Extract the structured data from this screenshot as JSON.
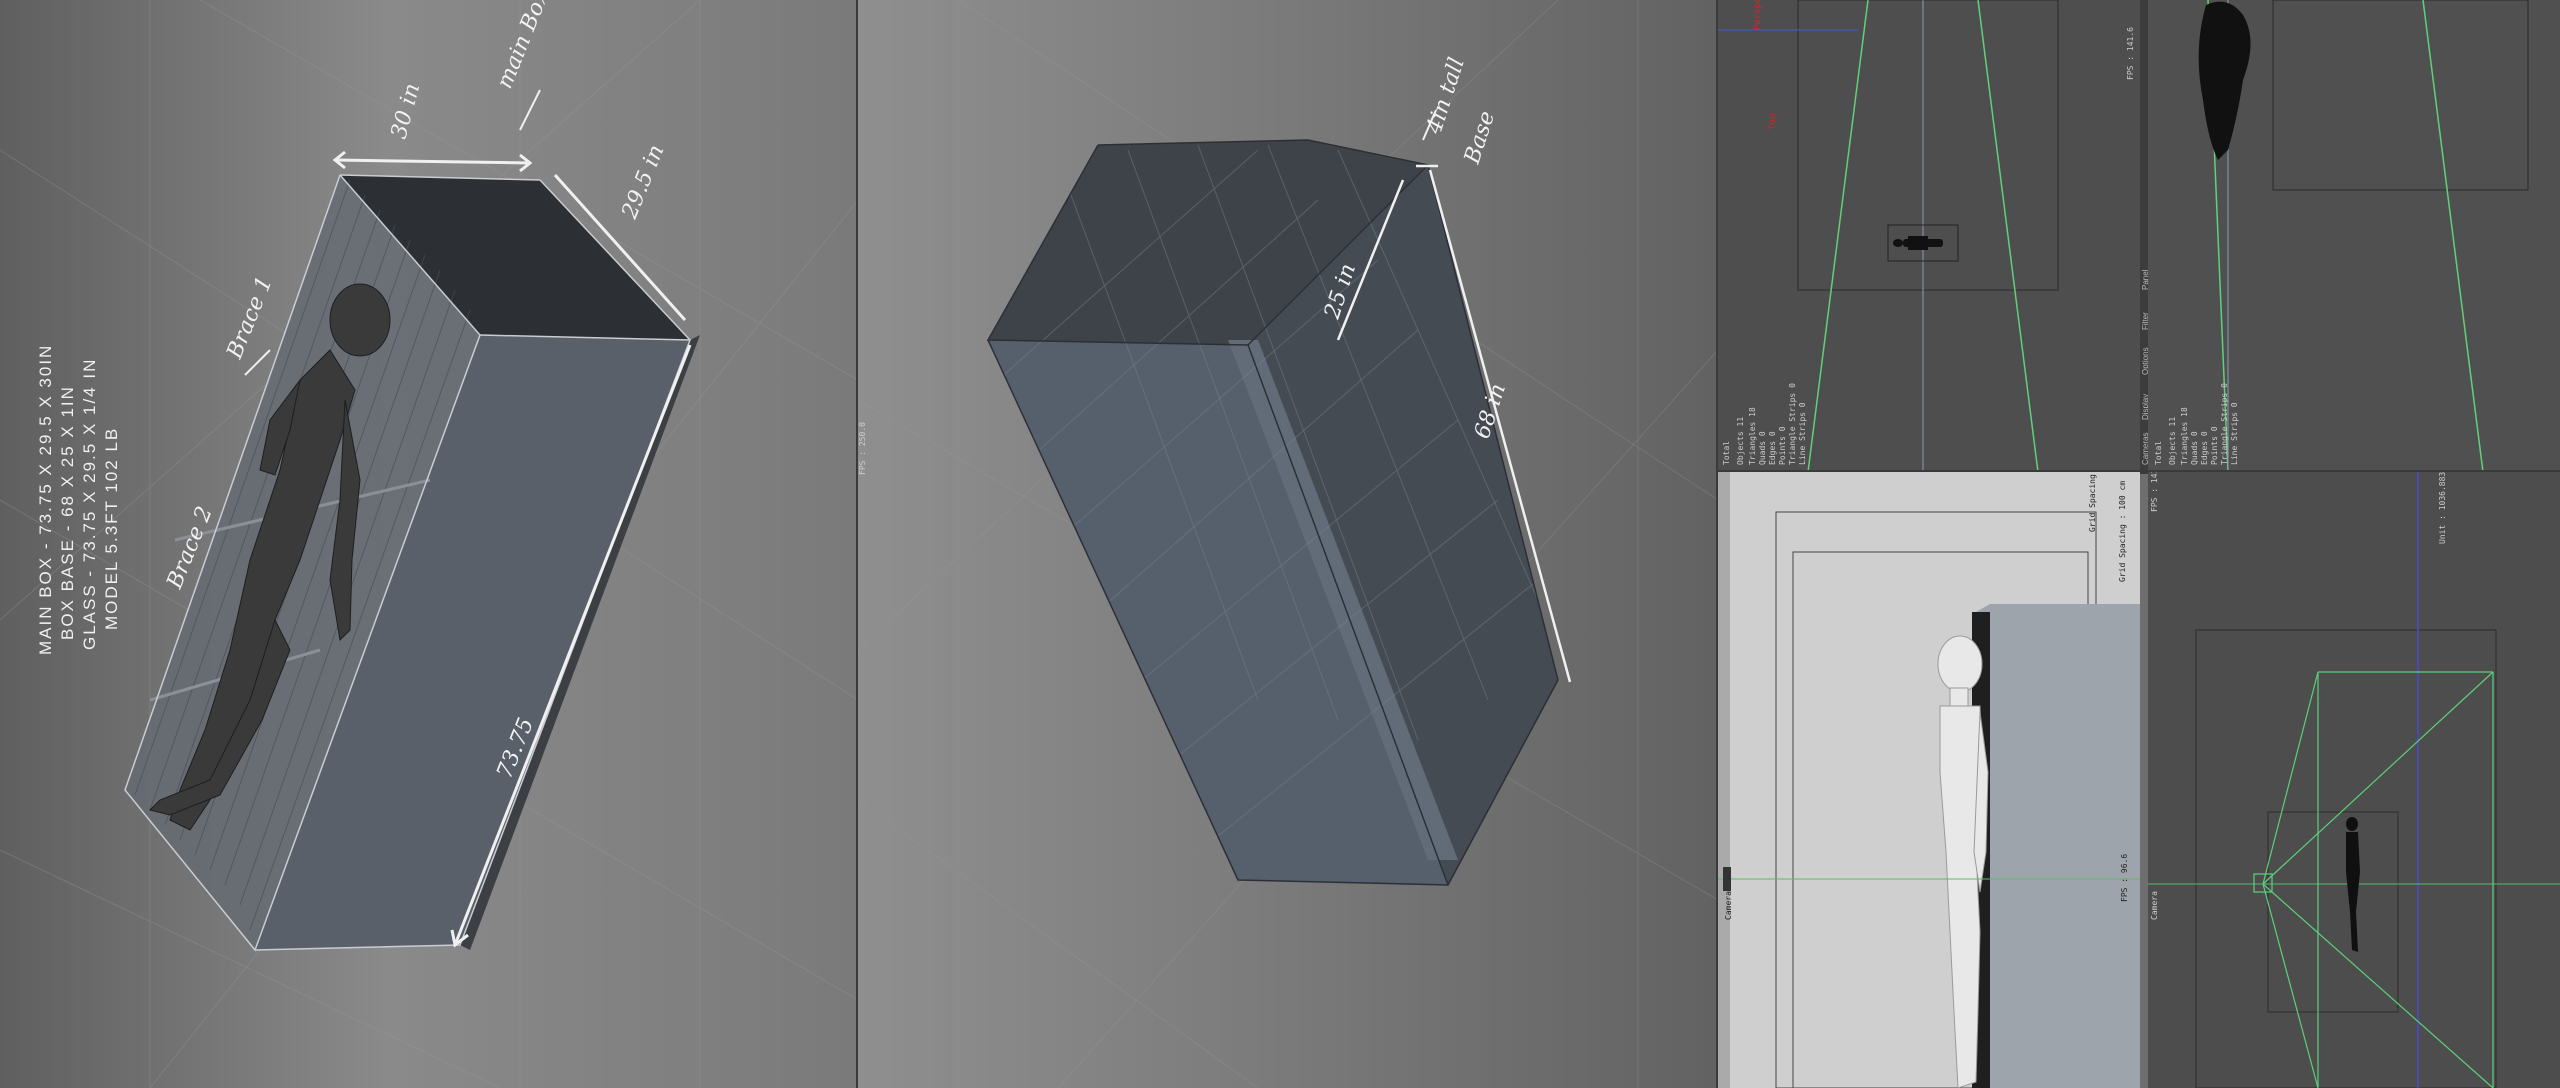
{
  "specs": {
    "main_box": "MAIN BOX -  73.75 X 29.5 X 30IN",
    "box_base": "BOX BASE - 68 X 25 X 1IN",
    "glass": "GLASS - 73.75 X 29.5 X 1/4 IN",
    "model": "MODEL 5.3FT 102 LB"
  },
  "annotations": {
    "width": "30 in",
    "main_box": "main Box",
    "depth": "29.5 in",
    "brace1": "Brace 1",
    "brace2": "Brace 2",
    "length": "73.75",
    "base_height": "4in tall",
    "base": "Base",
    "base_depth": "25 in",
    "base_length": "68 in"
  },
  "stats": {
    "header": "Total",
    "rows": [
      {
        "label": "Objects",
        "value": "11"
      },
      {
        "label": "Triangles",
        "value": "18"
      },
      {
        "label": "Quads",
        "value": "0"
      },
      {
        "label": "Edges",
        "value": "0"
      },
      {
        "label": "Points",
        "value": "0"
      },
      {
        "label": "Triangle Strips",
        "value": "0"
      },
      {
        "label": "Line Strips",
        "value": "0"
      }
    ]
  },
  "viewport_labels": {
    "fps_a": "FPS : 250.0",
    "fps_b": "FPS : 141.6",
    "fps_c": "FPS : 96.6",
    "fps_d": "FPS : 141.6",
    "grid_spacing": "Grid Spacing : 100 cm",
    "grid_spacing_b": "Grid Spacing : 1000 cm",
    "unit": "Unit : 1036.883 cm",
    "camera_a": "Camera",
    "camera_b": "Camera"
  },
  "menu_strip": [
    "Cameras",
    "Display",
    "Options",
    "Filter",
    "Panel"
  ],
  "red_labels": [
    "Perspective",
    "Top"
  ]
}
